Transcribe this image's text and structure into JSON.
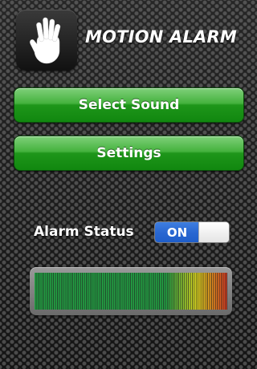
{
  "app": {
    "title": "MOTION ALARM",
    "icon": "hand-icon"
  },
  "buttons": {
    "select_sound": "Select Sound",
    "settings": "Settings"
  },
  "alarm": {
    "label": "Alarm Status",
    "toggle_label": "ON",
    "state": "on"
  },
  "meter": {
    "level": 1.0,
    "colors": {
      "low": "#22a544",
      "mid": "#e9e31d",
      "high": "#e2341f"
    }
  },
  "colors": {
    "button_green": "#1e961a",
    "toggle_blue": "#2a68d2"
  }
}
